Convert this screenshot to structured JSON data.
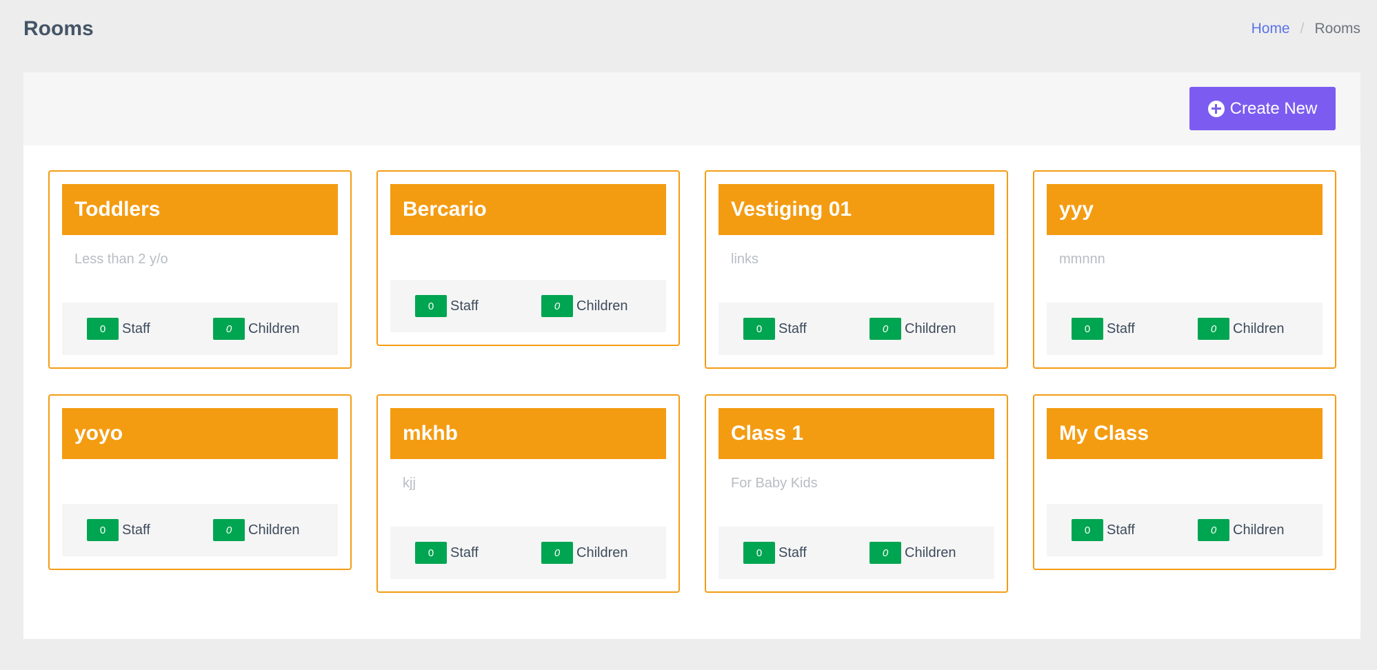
{
  "page": {
    "title": "Rooms"
  },
  "breadcrumb": {
    "home": "Home",
    "separator": "/",
    "current": "Rooms"
  },
  "toolbar": {
    "create_label": "Create New",
    "create_icon": "plus-circle-icon"
  },
  "colors": {
    "accent": "#f39c12",
    "button": "#7c5cf0",
    "badge": "#00a551",
    "link": "#5b73e8"
  },
  "rooms": [
    {
      "name": "Toddlers",
      "description": "Less than 2 y/o",
      "staff": "0",
      "children": "0",
      "staff_label": "Staff",
      "children_label": "Children"
    },
    {
      "name": "Bercario",
      "description": "",
      "staff": "0",
      "children": "0",
      "staff_label": "Staff",
      "children_label": "Children"
    },
    {
      "name": "Vestiging 01",
      "description": "links",
      "staff": "0",
      "children": "0",
      "staff_label": "Staff",
      "children_label": "Children"
    },
    {
      "name": "yyy",
      "description": "mmnnn",
      "staff": "0",
      "children": "0",
      "staff_label": "Staff",
      "children_label": "Children"
    },
    {
      "name": "yoyo",
      "description": "",
      "staff": "0",
      "children": "0",
      "staff_label": "Staff",
      "children_label": "Children"
    },
    {
      "name": "mkhb",
      "description": "kjj",
      "staff": "0",
      "children": "0",
      "staff_label": "Staff",
      "children_label": "Children"
    },
    {
      "name": "Class 1",
      "description": "For Baby Kids",
      "staff": "0",
      "children": "0",
      "staff_label": "Staff",
      "children_label": "Children"
    },
    {
      "name": "My Class",
      "description": "",
      "staff": "0",
      "children": "0",
      "staff_label": "Staff",
      "children_label": "Children"
    }
  ]
}
